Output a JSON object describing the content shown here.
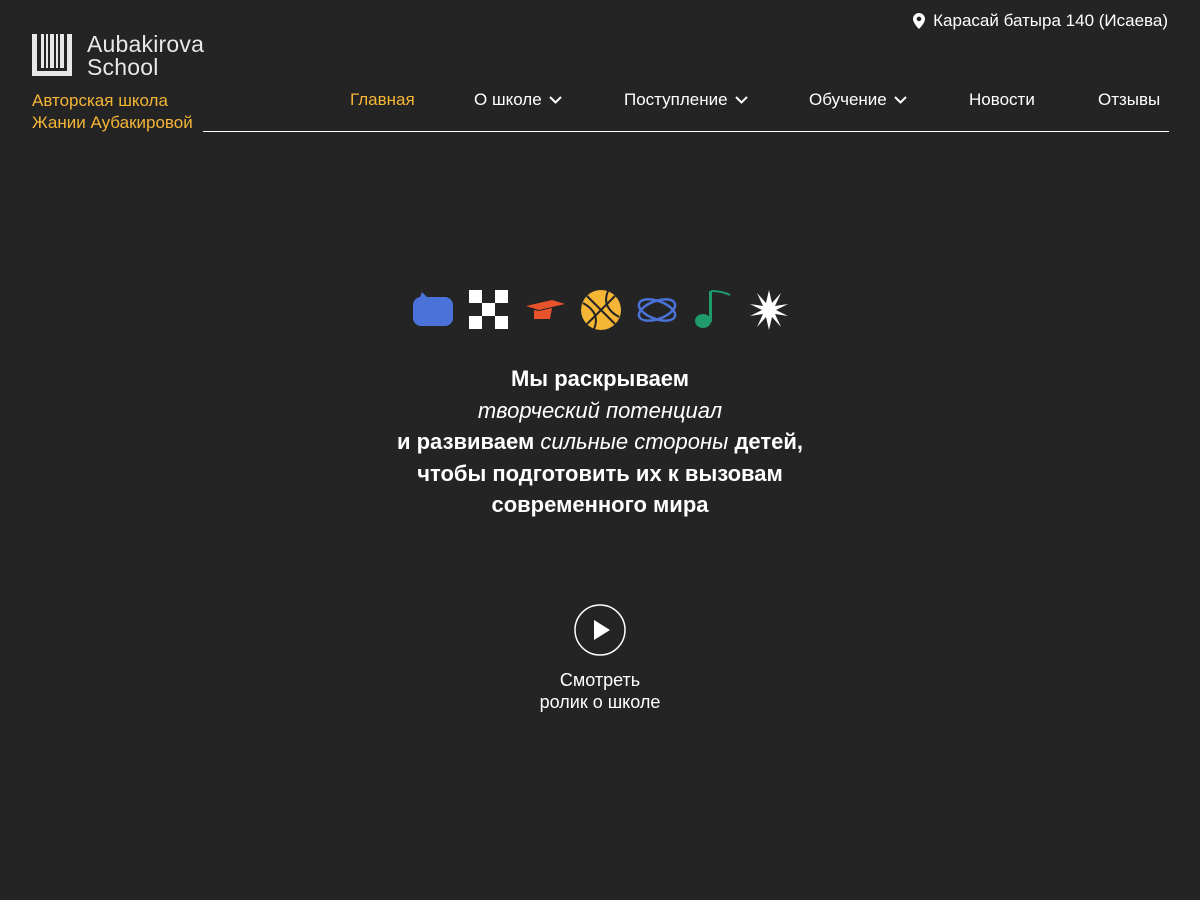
{
  "brand": {
    "name_line1": "Aubakirova",
    "name_line2": "School",
    "tagline_line1": "Авторская школа",
    "tagline_line2": "Жании Аубакировой",
    "accent_color": "#f5b535",
    "background_color": "#242424"
  },
  "address": {
    "icon": "location-pin-icon",
    "text": "Карасай батыра 140 (Исаева)"
  },
  "nav": {
    "items": [
      {
        "label": "Главная",
        "active": true,
        "dropdown": false
      },
      {
        "label": "О школе",
        "active": false,
        "dropdown": true
      },
      {
        "label": "Поступление",
        "active": false,
        "dropdown": true
      },
      {
        "label": "Обучение",
        "active": false,
        "dropdown": true
      },
      {
        "label": "Новости",
        "active": false,
        "dropdown": false
      },
      {
        "label": "Отзывы",
        "active": false,
        "dropdown": false
      }
    ]
  },
  "hero": {
    "icons": [
      {
        "name": "speech-bubble-icon",
        "color": "#4a72d9"
      },
      {
        "name": "checkerboard-icon",
        "color": "#ffffff"
      },
      {
        "name": "graduation-cap-icon",
        "color": "#e8532b"
      },
      {
        "name": "basketball-icon",
        "color": "#f5b535"
      },
      {
        "name": "atom-orbit-icon",
        "color": "#4a72d9"
      },
      {
        "name": "music-note-icon",
        "color": "#1f9a6a"
      },
      {
        "name": "starburst-icon",
        "color": "#ffffff"
      }
    ],
    "headline": {
      "line1": "Мы раскрываем",
      "line2": "творческий потенциал",
      "line3_a": "и развиваем",
      "line3_b": "сильные стороны",
      "line3_c": "детей",
      "line3_d": ",",
      "line4": "чтобы подготовить их к вызовам",
      "line5": "современного мира"
    },
    "video": {
      "icon": "play-icon",
      "label_line1": "Смотреть",
      "label_line2": "ролик о школе"
    }
  }
}
